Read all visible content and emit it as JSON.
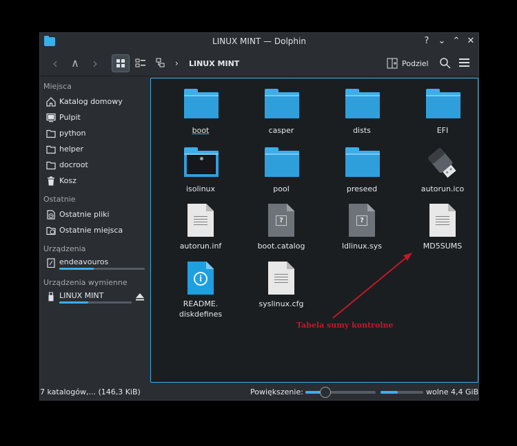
{
  "window": {
    "title": "LINUX MINT — Dolphin"
  },
  "titlebar": {
    "help": "?",
    "minimize": "⌄",
    "maximize": "⌃",
    "close": "✕"
  },
  "toolbar": {
    "back": "‹",
    "up": "∧",
    "forward": "›",
    "breadcrumb_sep": "›",
    "breadcrumb": "LINUX MINT",
    "split_label": "Podziel"
  },
  "sidebar": {
    "places_title": "Miejsca",
    "places": [
      {
        "label": "Katalog domowy",
        "icon": "home-icon"
      },
      {
        "label": "Pulpit",
        "icon": "desktop-icon"
      },
      {
        "label": "python",
        "icon": "folder-icon"
      },
      {
        "label": "helper",
        "icon": "folder-icon"
      },
      {
        "label": "docroot",
        "icon": "folder-icon"
      },
      {
        "label": "Kosz",
        "icon": "trash-icon"
      }
    ],
    "recent_title": "Ostatnie",
    "recent": [
      {
        "label": "Ostatnie pliki",
        "icon": "recent-files-icon"
      },
      {
        "label": "Ostatnie miejsca",
        "icon": "recent-places-icon"
      }
    ],
    "devices_title": "Urządzenia",
    "devices": [
      {
        "label": "endeavouros",
        "icon": "drive-icon",
        "usage": 0.4
      }
    ],
    "removable_title": "Urządzenia wymienne",
    "removable": [
      {
        "label": "LINUX MINT",
        "icon": "usb-drive-icon",
        "usage": 0.4
      }
    ]
  },
  "files": [
    {
      "name": "boot",
      "type": "folder"
    },
    {
      "name": "casper",
      "type": "folder"
    },
    {
      "name": "dists",
      "type": "folder"
    },
    {
      "name": "EFI",
      "type": "folder"
    },
    {
      "name": "isolinux",
      "type": "folder-image"
    },
    {
      "name": "pool",
      "type": "folder"
    },
    {
      "name": "preseed",
      "type": "folder"
    },
    {
      "name": "autorun.ico",
      "type": "usb-image"
    },
    {
      "name": "autorun.inf",
      "type": "text"
    },
    {
      "name": "boot.catalog",
      "type": "unknown"
    },
    {
      "name": "ldlinux.sys",
      "type": "unknown"
    },
    {
      "name": "MD5SUMS",
      "type": "text"
    },
    {
      "name": "README.\ndiskdefines",
      "type": "info"
    },
    {
      "name": "syslinux.cfg",
      "type": "text"
    }
  ],
  "statusbar": {
    "summary": "7 katalogów,... (146,3 KiB)",
    "zoom_label": "Powiększenie:",
    "zoom_level": 0.28,
    "free_usage": 0.4,
    "free_label": "wolne 4,4 GiB"
  },
  "annotation": {
    "text": "Tabela sumy kontrolne",
    "color": "#c0182a"
  },
  "colors": {
    "accent": "#3daee9",
    "window_bg": "#2a2e32",
    "view_bg": "#1b1e20"
  }
}
